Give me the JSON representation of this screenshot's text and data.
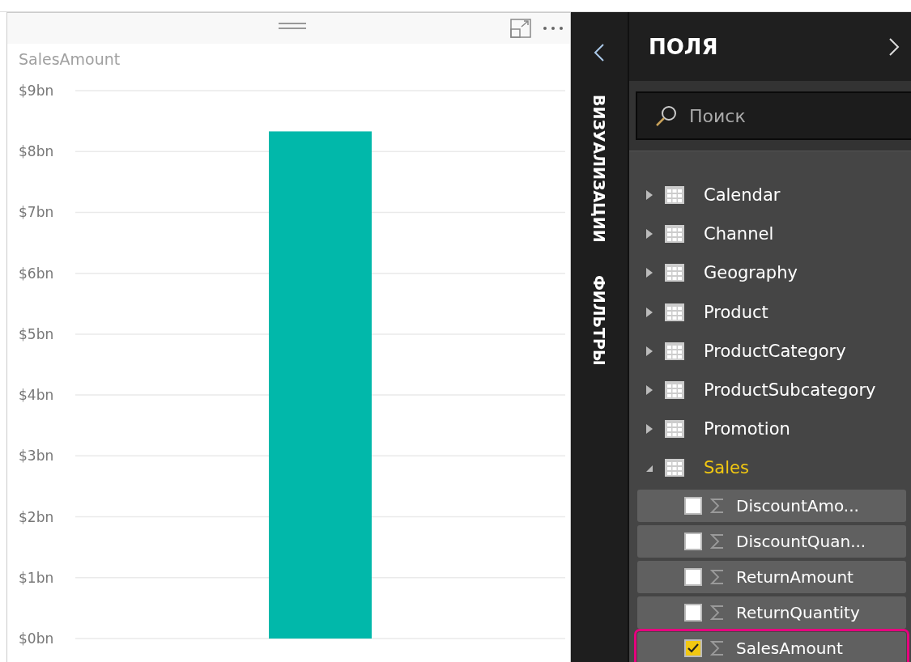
{
  "chart": {
    "chart_data": {
      "type": "bar",
      "title": "SalesAmount",
      "values": [
        8.33
      ],
      "ylim": [
        0,
        9
      ],
      "grid": true,
      "yticks": [
        {
          "value": 0,
          "label": "$0bn"
        },
        {
          "value": 1,
          "label": "$1bn"
        },
        {
          "value": 2,
          "label": "$2bn"
        },
        {
          "value": 3,
          "label": "$3bn"
        },
        {
          "value": 4,
          "label": "$4bn"
        },
        {
          "value": 5,
          "label": "$5bn"
        },
        {
          "value": 6,
          "label": "$6bn"
        },
        {
          "value": 7,
          "label": "$7bn"
        },
        {
          "value": 8,
          "label": "$8bn"
        },
        {
          "value": 9,
          "label": "$9bn"
        }
      ]
    }
  },
  "side_tabs": [
    "ВИЗУАЛИЗАЦИИ",
    "ФИЛЬТРЫ"
  ],
  "fields_pane": {
    "title": "ПОЛЯ",
    "search": {
      "placeholder": "Поиск"
    },
    "tables": [
      {
        "name": "Calendar",
        "expanded": false,
        "active": false
      },
      {
        "name": "Channel",
        "expanded": false,
        "active": false
      },
      {
        "name": "Geography",
        "expanded": false,
        "active": false
      },
      {
        "name": "Product",
        "expanded": false,
        "active": false
      },
      {
        "name": "ProductCategory",
        "expanded": false,
        "active": false
      },
      {
        "name": "ProductSubcategory",
        "expanded": false,
        "active": false
      },
      {
        "name": "Promotion",
        "expanded": false,
        "active": false
      },
      {
        "name": "Sales",
        "expanded": true,
        "active": true,
        "fields": [
          {
            "name": "DiscountAmo...",
            "checked": false,
            "highlighted": false
          },
          {
            "name": "DiscountQuan...",
            "checked": false,
            "highlighted": false
          },
          {
            "name": "ReturnAmount",
            "checked": false,
            "highlighted": false
          },
          {
            "name": "ReturnQuantity",
            "checked": false,
            "highlighted": false
          },
          {
            "name": "SalesAmount",
            "checked": true,
            "highlighted": true
          }
        ]
      }
    ]
  }
}
